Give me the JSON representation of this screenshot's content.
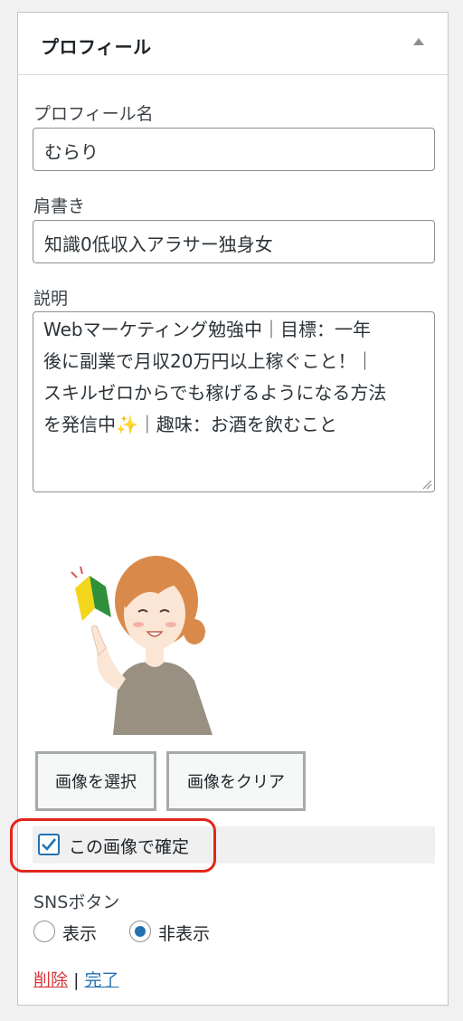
{
  "widget": {
    "title": "プロフィール",
    "collapse_icon": "triangle-up-icon"
  },
  "fields": {
    "profile_name_label": "プロフィール名",
    "profile_name_value": "むらり",
    "title_label": "肩書き",
    "title_value": "知識0低収入アラサー独身女",
    "description_label": "説明",
    "description_lines": [
      "Webマーケティング勉強中｜目標：一年",
      "後に副業で月収20万円以上稼ぐこと！｜",
      "スキルゼロからでも稼げるようになる方法",
      "を発信中",
      "｜趣味：お酒を飲むこと"
    ],
    "sparkle_icon": "sparkles-icon"
  },
  "image": {
    "select_label": "画像を選択",
    "clear_label": "画像をクリア",
    "confirm_label": "この画像で確定",
    "confirm_checked": true
  },
  "sns": {
    "label": "SNSボタン",
    "options": [
      "表示",
      "非表示"
    ],
    "selected": "非表示"
  },
  "actions": {
    "delete": "削除",
    "separator": "|",
    "done": "完了"
  },
  "colors": {
    "highlight": "#e2261b",
    "accent": "#2271b1",
    "delete": "#d63638"
  }
}
